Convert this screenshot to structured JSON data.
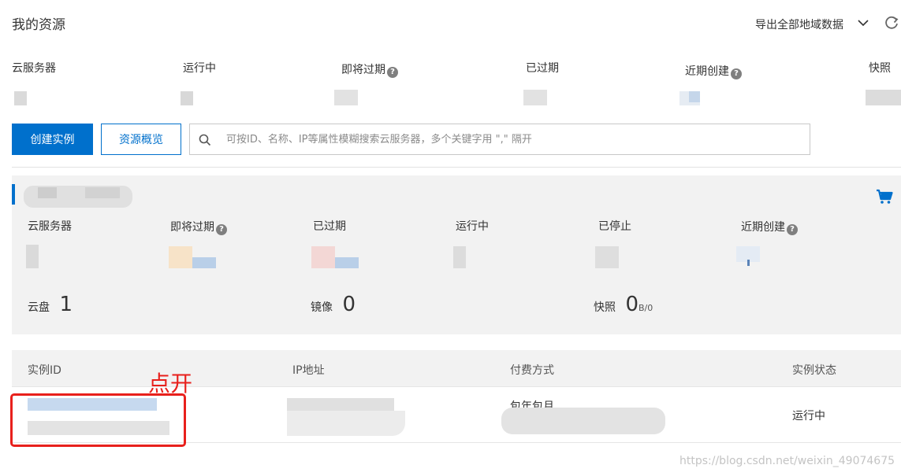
{
  "header": {
    "title": "我的资源",
    "export_label": "导出全部地域数据"
  },
  "summary": {
    "items": [
      {
        "label": "云服务器",
        "help": false
      },
      {
        "label": "运行中",
        "help": false
      },
      {
        "label": "即将过期",
        "help": true
      },
      {
        "label": "已过期",
        "help": false
      },
      {
        "label": "近期创建",
        "help": true
      },
      {
        "label": "快照",
        "help": false
      }
    ]
  },
  "toolbar": {
    "create_label": "创建实例",
    "overview_label": "资源概览",
    "search_placeholder": "可按ID、名称、IP等属性模糊搜索云服务器，多个关键字用 \",\" 隔开"
  },
  "region": {
    "stats": [
      {
        "label": "云服务器",
        "help": false
      },
      {
        "label": "即将过期",
        "help": true
      },
      {
        "label": "已过期",
        "help": false
      },
      {
        "label": "运行中",
        "help": false
      },
      {
        "label": "已停止",
        "help": false
      },
      {
        "label": "近期创建",
        "help": true
      }
    ],
    "disk_label": "云盘",
    "disk_count": "1",
    "image_label": "镜像",
    "image_count": "0",
    "snapshot_label": "快照",
    "snapshot_count": "0",
    "snapshot_suffix": "B/0"
  },
  "table": {
    "columns": [
      "实例ID",
      "IP地址",
      "付费方式",
      "实例状态"
    ],
    "rows": [
      {
        "billing_partial": "包年包月",
        "status": "运行中"
      }
    ]
  },
  "annotation": {
    "text": "点开"
  },
  "watermark": "https://blog.csdn.net/weixin_49074675",
  "colors": {
    "primary": "#0070cc",
    "annotation": "#e8201c",
    "panel_bg": "#f2f2f2"
  }
}
